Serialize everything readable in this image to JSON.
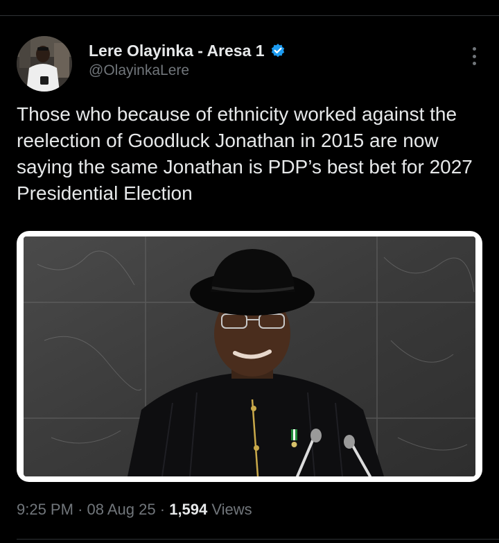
{
  "tweet": {
    "author": {
      "display_name": "Lere Olayinka - Aresa 1",
      "handle": "@OlayinkaLere",
      "verified": true,
      "verified_color": "#1d9bf0",
      "avatar_icon": "profile-photo"
    },
    "more_icon": "more-vertical-icon",
    "text": "Those who because of ethnicity worked against the reelection of Goodluck Jonathan in 2015 are now saying the same Jonathan is PDP’s best bet for 2027 Presidential Election",
    "media": {
      "description_icon": "photo-of-man-in-black-hat-speaking-at-podium"
    },
    "meta": {
      "time": "9:25 PM",
      "separator": "·",
      "date": "08 Aug 25",
      "views_count": "1,594",
      "views_label": "Views"
    }
  },
  "colors": {
    "background": "#000000",
    "text_primary": "#e7e9ea",
    "text_secondary": "#71767b",
    "divider": "#2f3336",
    "accent": "#1d9bf0"
  }
}
